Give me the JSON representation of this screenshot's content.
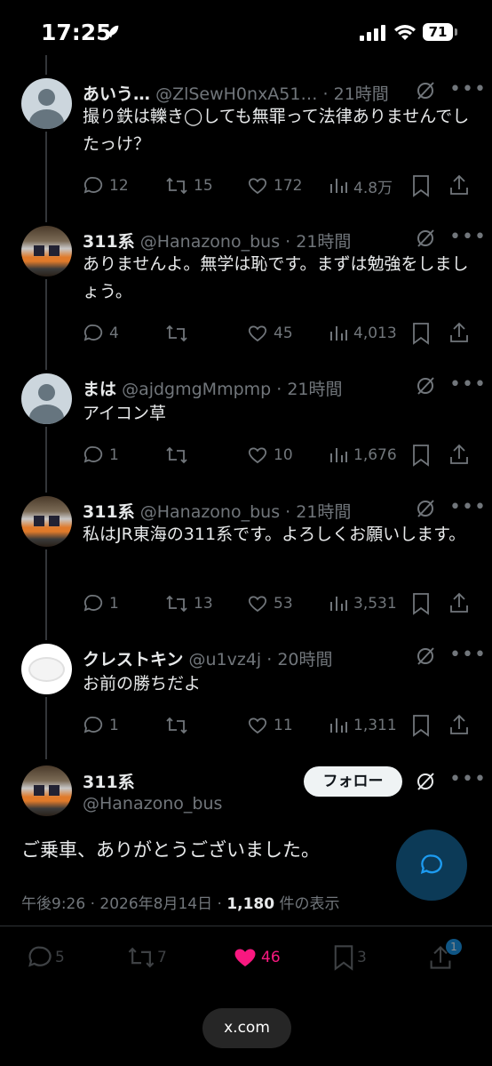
{
  "status": {
    "time": "17:25",
    "battery": "71"
  },
  "tweets": [
    {
      "name": "あいう…",
      "handle": "@ZlSewH0nxA51…",
      "time": "· 21時間",
      "avatar": "default-avatar",
      "text": "撮り鉄は轢き◯しても無罪って法律ありませんでしたっけ？",
      "replies": "12",
      "retweets": "15",
      "likes": "172",
      "views": "4.8万"
    },
    {
      "name": "311系",
      "handle": "@Hanazono_bus",
      "time": "· 21時間",
      "avatar": "train-avatar",
      "text": "ありませんよ。無学は恥です。まずは勉強をしましょう。",
      "replies": "4",
      "retweets": "",
      "likes": "45",
      "views": "4,013"
    },
    {
      "name": "まは",
      "handle": "@ajdgmgMmpmp",
      "time": "· 21時間",
      "avatar": "default-avatar",
      "text": "アイコン草",
      "replies": "1",
      "retweets": "",
      "likes": "10",
      "views": "1,676"
    },
    {
      "name": "311系",
      "handle": "@Hanazono_bus",
      "time": "· 21時間",
      "avatar": "train-avatar",
      "text": "私はJR東海の311系です。よろしくお願いします。",
      "replies": "1",
      "retweets": "13",
      "likes": "53",
      "views": "3,531"
    },
    {
      "name": "クレストキン",
      "handle": "@u1vz4j",
      "time": "· 20時間",
      "avatar": "cloud-avatar",
      "text": "お前の勝ちだよ",
      "replies": "1",
      "retweets": "",
      "likes": "11",
      "views": "1,311"
    }
  ],
  "main_post": {
    "name": "311系",
    "handle": "@Hanazono_bus",
    "follow_label": "フォロー",
    "text": "ご乗車、ありがとうございました。",
    "timestamp": "午後9:26 · 2026年8月14日 · ",
    "views": "1,180",
    "views_suffix": " 件の表示"
  },
  "bottom_bar": {
    "replies": "5",
    "retweets": "7",
    "likes": "46",
    "bookmarks": "3",
    "badge": "1"
  },
  "url": "x.com"
}
